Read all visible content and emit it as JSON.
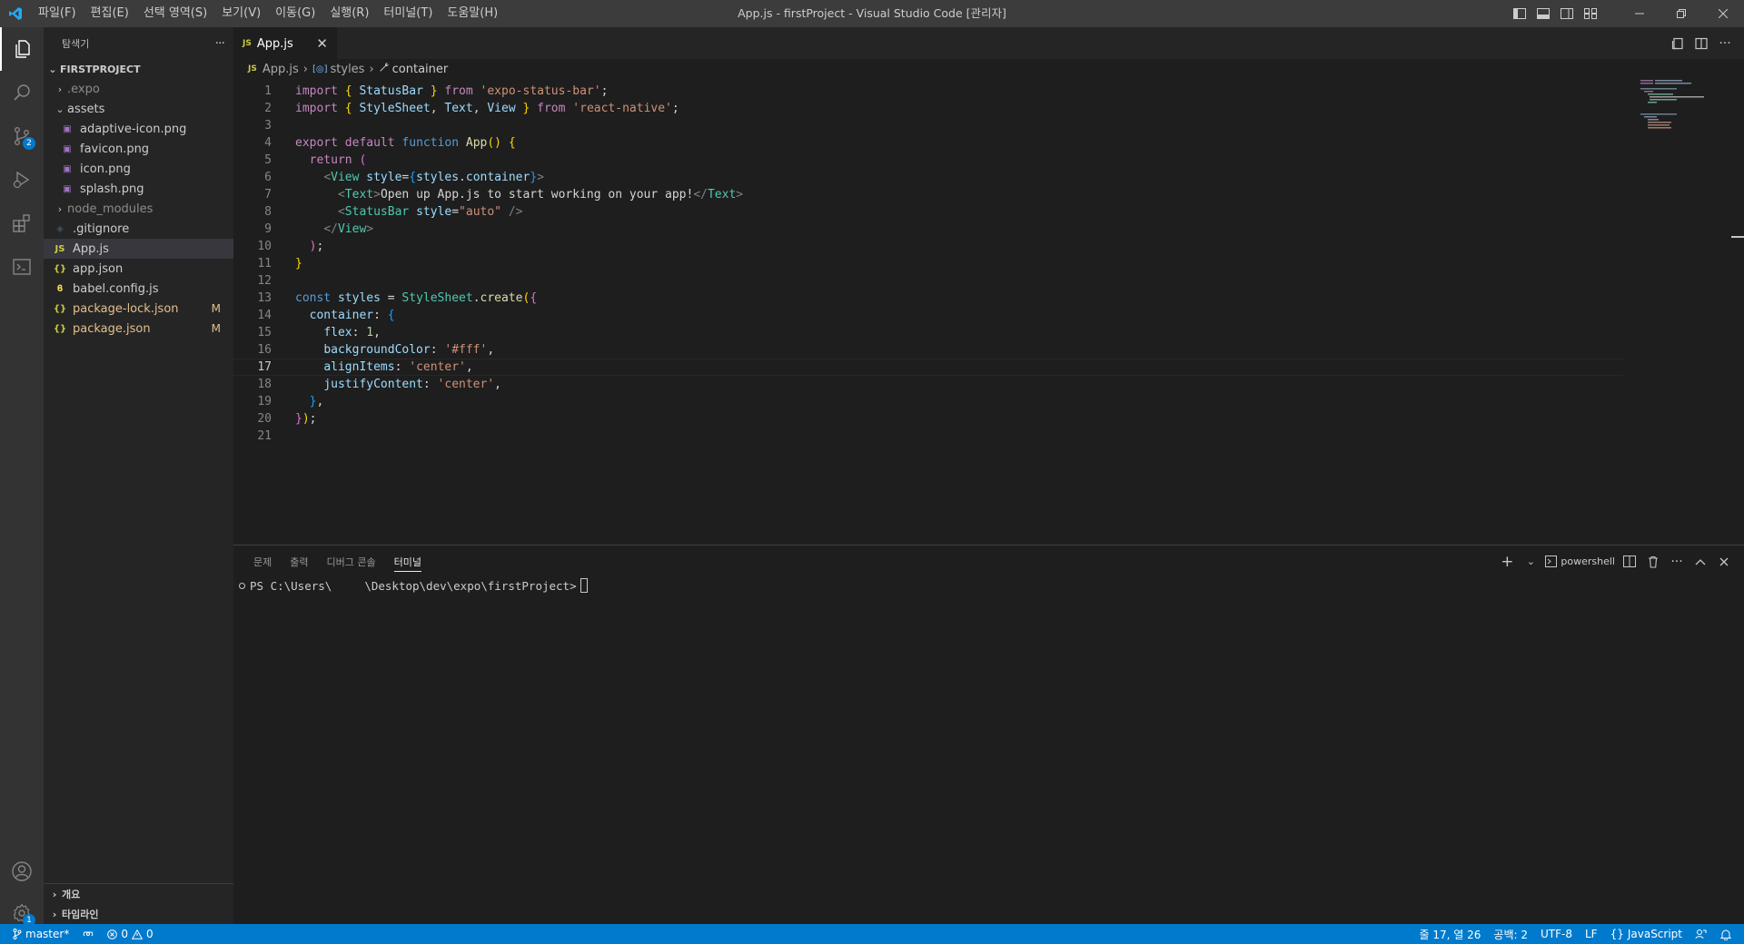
{
  "window": {
    "title": "App.js - firstProject - Visual Studio Code [관리자]",
    "menu": [
      "파일(F)",
      "편집(E)",
      "선택 영역(S)",
      "보기(V)",
      "이동(G)",
      "실행(R)",
      "터미널(T)",
      "도움말(H)"
    ]
  },
  "activity_bar": {
    "items": [
      {
        "name": "explorer-icon",
        "active": true
      },
      {
        "name": "search-icon"
      },
      {
        "name": "source-control-icon",
        "badge": "2"
      },
      {
        "name": "run-debug-icon"
      },
      {
        "name": "extensions-icon"
      },
      {
        "name": "remote-explorer-icon"
      }
    ],
    "bottom": [
      {
        "name": "account-icon"
      },
      {
        "name": "manage-gear-icon",
        "badge": "1"
      }
    ]
  },
  "sidebar": {
    "title": "탐색기",
    "more": "···",
    "project": "FIRSTPROJECT",
    "tree": [
      {
        "label": ".expo",
        "type": "folder",
        "expanded": false,
        "depth": 1,
        "dim": true
      },
      {
        "label": "assets",
        "type": "folder",
        "expanded": true,
        "depth": 1
      },
      {
        "label": "adaptive-icon.png",
        "type": "image",
        "depth": 2
      },
      {
        "label": "favicon.png",
        "type": "image",
        "depth": 2
      },
      {
        "label": "icon.png",
        "type": "image",
        "depth": 2
      },
      {
        "label": "splash.png",
        "type": "image",
        "depth": 2
      },
      {
        "label": "node_modules",
        "type": "folder",
        "expanded": false,
        "depth": 1,
        "dim": true
      },
      {
        "label": ".gitignore",
        "type": "git",
        "depth": 1
      },
      {
        "label": "App.js",
        "type": "js",
        "depth": 1,
        "selected": true
      },
      {
        "label": "app.json",
        "type": "json",
        "depth": 1
      },
      {
        "label": "babel.config.js",
        "type": "babel",
        "depth": 1
      },
      {
        "label": "package-lock.json",
        "type": "json",
        "depth": 1,
        "modified": "M"
      },
      {
        "label": "package.json",
        "type": "json",
        "depth": 1,
        "modified": "M"
      }
    ],
    "sections": [
      "개요",
      "타임라인"
    ]
  },
  "editor": {
    "tab": {
      "icon": "JS",
      "label": "App.js",
      "close": "✕"
    },
    "breadcrumb": {
      "file_icon": "JS",
      "file": "App.js",
      "symbol1": "styles",
      "symbol2": "container"
    },
    "current_line": 17,
    "lines": [
      {
        "n": "1",
        "tokens": [
          [
            "kw",
            "import"
          ],
          [
            "p",
            " "
          ],
          [
            "br1",
            "{"
          ],
          [
            "p",
            " "
          ],
          [
            "var",
            "StatusBar"
          ],
          [
            "p",
            " "
          ],
          [
            "br1",
            "}"
          ],
          [
            "p",
            " "
          ],
          [
            "kw",
            "from"
          ],
          [
            "p",
            " "
          ],
          [
            "str",
            "'expo-status-bar'"
          ],
          [
            "p",
            ";"
          ]
        ]
      },
      {
        "n": "2",
        "tokens": [
          [
            "kw",
            "import"
          ],
          [
            "p",
            " "
          ],
          [
            "br1",
            "{"
          ],
          [
            "p",
            " "
          ],
          [
            "var",
            "StyleSheet"
          ],
          [
            "p",
            ", "
          ],
          [
            "var",
            "Text"
          ],
          [
            "p",
            ", "
          ],
          [
            "var",
            "View"
          ],
          [
            "p",
            " "
          ],
          [
            "br1",
            "}"
          ],
          [
            "p",
            " "
          ],
          [
            "kw",
            "from"
          ],
          [
            "p",
            " "
          ],
          [
            "str",
            "'react-native'"
          ],
          [
            "p",
            ";"
          ]
        ]
      },
      {
        "n": "3",
        "tokens": []
      },
      {
        "n": "4",
        "tokens": [
          [
            "kw",
            "export"
          ],
          [
            "p",
            " "
          ],
          [
            "kw",
            "default"
          ],
          [
            "p",
            " "
          ],
          [
            "kw2",
            "function"
          ],
          [
            "p",
            " "
          ],
          [
            "fn",
            "App"
          ],
          [
            "br1",
            "()"
          ],
          [
            "p",
            " "
          ],
          [
            "br1",
            "{"
          ]
        ]
      },
      {
        "n": "5",
        "tokens": [
          [
            "p",
            "  "
          ],
          [
            "kw",
            "return"
          ],
          [
            "p",
            " "
          ],
          [
            "br2",
            "("
          ]
        ]
      },
      {
        "n": "6",
        "tokens": [
          [
            "p",
            "    "
          ],
          [
            "ang",
            "<"
          ],
          [
            "tag",
            "View"
          ],
          [
            "p",
            " "
          ],
          [
            "var",
            "style"
          ],
          [
            "p",
            "="
          ],
          [
            "br3",
            "{"
          ],
          [
            "var",
            "styles"
          ],
          [
            "p",
            "."
          ],
          [
            "var",
            "container"
          ],
          [
            "br3",
            "}"
          ],
          [
            "ang",
            ">"
          ]
        ]
      },
      {
        "n": "7",
        "tokens": [
          [
            "p",
            "      "
          ],
          [
            "ang",
            "<"
          ],
          [
            "tag",
            "Text"
          ],
          [
            "ang",
            ">"
          ],
          [
            "p",
            "Open up App.js to start working on your app!"
          ],
          [
            "ang",
            "</"
          ],
          [
            "tag",
            "Text"
          ],
          [
            "ang",
            ">"
          ]
        ]
      },
      {
        "n": "8",
        "tokens": [
          [
            "p",
            "      "
          ],
          [
            "ang",
            "<"
          ],
          [
            "tag",
            "StatusBar"
          ],
          [
            "p",
            " "
          ],
          [
            "var",
            "style"
          ],
          [
            "p",
            "="
          ],
          [
            "str",
            "\"auto\""
          ],
          [
            "p",
            " "
          ],
          [
            "ang",
            "/>"
          ]
        ]
      },
      {
        "n": "9",
        "tokens": [
          [
            "p",
            "    "
          ],
          [
            "ang",
            "</"
          ],
          [
            "tag",
            "View"
          ],
          [
            "ang",
            ">"
          ]
        ]
      },
      {
        "n": "10",
        "tokens": [
          [
            "p",
            "  "
          ],
          [
            "br2",
            ")"
          ],
          [
            "p",
            ";"
          ]
        ]
      },
      {
        "n": "11",
        "tokens": [
          [
            "br1",
            "}"
          ]
        ]
      },
      {
        "n": "12",
        "tokens": []
      },
      {
        "n": "13",
        "tokens": [
          [
            "kw2",
            "const"
          ],
          [
            "p",
            " "
          ],
          [
            "var",
            "styles"
          ],
          [
            "p",
            " = "
          ],
          [
            "cls",
            "StyleSheet"
          ],
          [
            "p",
            "."
          ],
          [
            "fn",
            "create"
          ],
          [
            "br1",
            "("
          ],
          [
            "br2",
            "{"
          ]
        ]
      },
      {
        "n": "14",
        "tokens": [
          [
            "p",
            "  "
          ],
          [
            "var",
            "container"
          ],
          [
            "p",
            ": "
          ],
          [
            "br3",
            "{"
          ]
        ]
      },
      {
        "n": "15",
        "tokens": [
          [
            "p",
            "    "
          ],
          [
            "var",
            "flex"
          ],
          [
            "p",
            ": "
          ],
          [
            "num",
            "1"
          ],
          [
            "p",
            ","
          ]
        ]
      },
      {
        "n": "16",
        "tokens": [
          [
            "p",
            "    "
          ],
          [
            "var",
            "backgroundColor"
          ],
          [
            "p",
            ": "
          ],
          [
            "str",
            "'#fff'"
          ],
          [
            "p",
            ","
          ]
        ]
      },
      {
        "n": "17",
        "tokens": [
          [
            "p",
            "    "
          ],
          [
            "var",
            "alignItems"
          ],
          [
            "p",
            ": "
          ],
          [
            "str",
            "'center'"
          ],
          [
            "p",
            ","
          ]
        ]
      },
      {
        "n": "18",
        "tokens": [
          [
            "p",
            "    "
          ],
          [
            "var",
            "justifyContent"
          ],
          [
            "p",
            ": "
          ],
          [
            "str",
            "'center'"
          ],
          [
            "p",
            ","
          ]
        ]
      },
      {
        "n": "19",
        "tokens": [
          [
            "p",
            "  "
          ],
          [
            "br3",
            "}"
          ],
          [
            "p",
            ","
          ]
        ]
      },
      {
        "n": "20",
        "tokens": [
          [
            "br2",
            "}"
          ],
          [
            "br1",
            ")"
          ],
          [
            "p",
            ";"
          ]
        ]
      },
      {
        "n": "21",
        "tokens": []
      }
    ]
  },
  "panel": {
    "tabs": [
      "문제",
      "출력",
      "디버그 콘솔",
      "터미널"
    ],
    "active_tab": "터미널",
    "terminal_name": "powershell",
    "prompt_user": "PS C:\\Users\\",
    "prompt_path": "\\Desktop\\dev\\expo\\firstProject>"
  },
  "statusbar": {
    "branch": "master*",
    "errors": "0",
    "warnings": "0",
    "position": "줄 17, 열 26",
    "indent": "공백: 2",
    "encoding": "UTF-8",
    "eol": "LF",
    "language": "JavaScript"
  },
  "colors": {
    "accent": "#007acc",
    "titlebar": "#3c3c3c",
    "activitybar": "#333333",
    "sidebar": "#252526",
    "editor": "#1e1e1e",
    "modified": "#e2c08d"
  }
}
